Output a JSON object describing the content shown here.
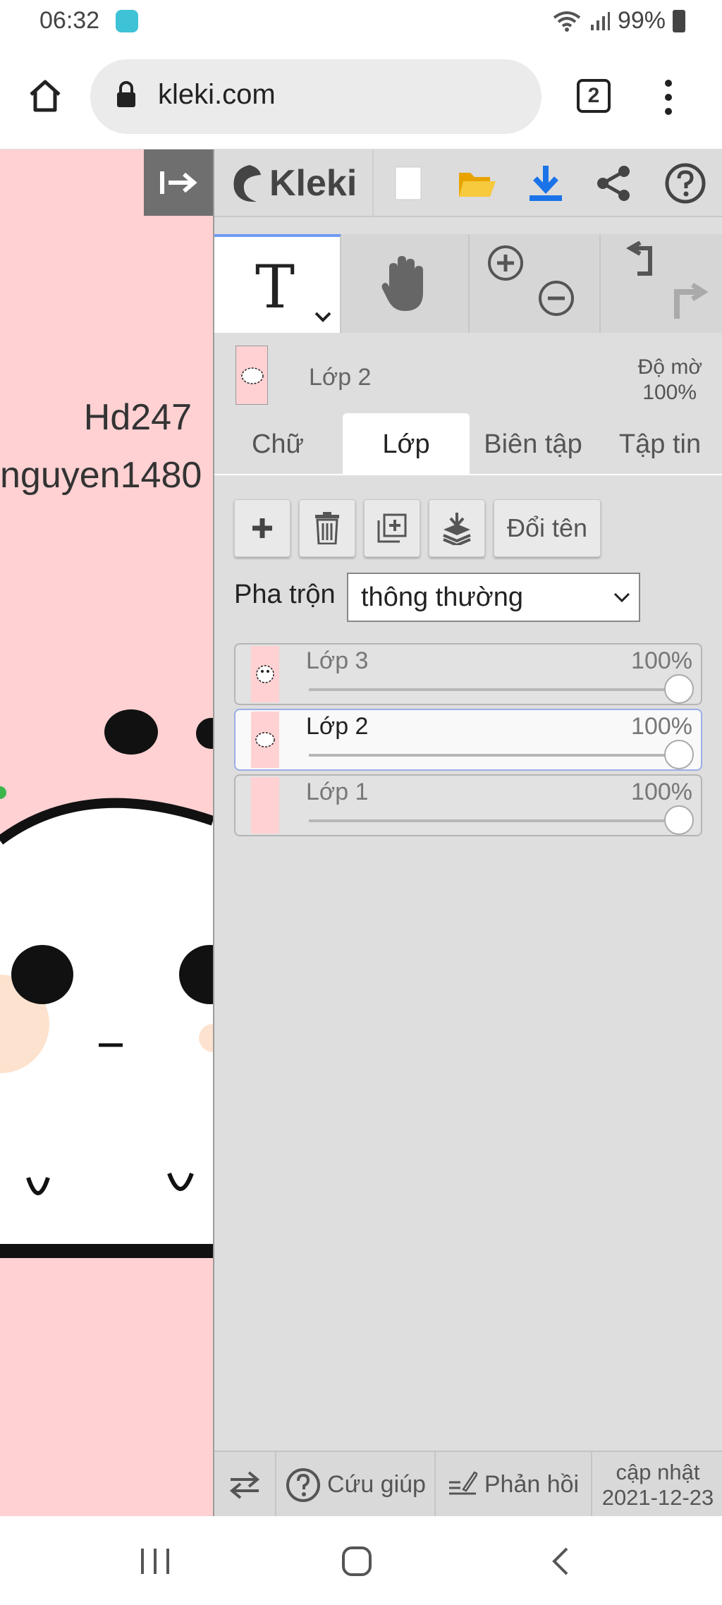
{
  "status_bar": {
    "time": "06:32",
    "battery": "99%"
  },
  "browser": {
    "url": "kleki.com",
    "tab_count": "2"
  },
  "canvas": {
    "text_line1": "Hd247",
    "text_line2": "nguyen1480"
  },
  "app": {
    "logo": "Kleki"
  },
  "layer_info": {
    "name": "Lớp 2",
    "opacity_label": "Độ mờ",
    "opacity_value": "100%"
  },
  "tabs": [
    {
      "label": "Chữ"
    },
    {
      "label": "Lớp"
    },
    {
      "label": "Biên tập"
    },
    {
      "label": "Tập tin"
    }
  ],
  "layer_actions": {
    "rename": "Đổi tên"
  },
  "blend": {
    "label": "Pha trộn",
    "value": "thông thường"
  },
  "layers": [
    {
      "name": "Lớp 3",
      "opacity": "100%"
    },
    {
      "name": "Lớp 2",
      "opacity": "100%"
    },
    {
      "name": "Lớp 1",
      "opacity": "100%"
    }
  ],
  "bottom_bar": {
    "help": "Cứu giúp",
    "feedback": "Phản hồi",
    "update_label": "cập nhật",
    "update_date": "2021-12-23"
  },
  "colors": {
    "canvas_bg": "#ffd1d3",
    "panel_bg": "#dedede",
    "accent_blue": "#1a73e8",
    "folder_yellow": "#f5b80c"
  },
  "icons": [
    "home-icon",
    "lock-icon",
    "tabs-icon",
    "menu-icon",
    "collapse-icon",
    "new-icon",
    "open-icon",
    "download-icon",
    "share-icon",
    "help-icon",
    "text-tool-icon",
    "hand-icon",
    "zoom-in-icon",
    "zoom-out-icon",
    "undo-icon",
    "redo-icon",
    "add-layer-icon",
    "delete-icon",
    "duplicate-icon",
    "merge-icon",
    "swap-icon",
    "feedback-icon"
  ]
}
